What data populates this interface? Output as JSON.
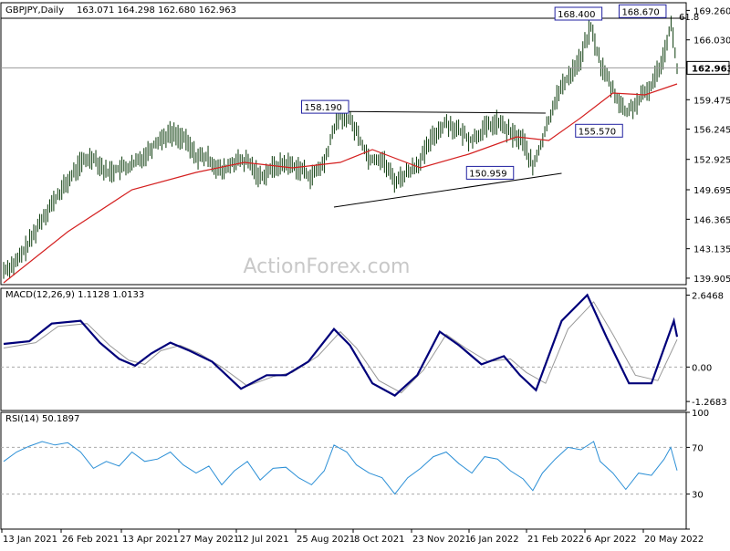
{
  "chart_data": [
    {
      "type": "candlestick-ohlc",
      "title": "GBPJPY,Daily",
      "ohlc_readout": [
        "163.071",
        "164.298",
        "162.680",
        "162.963"
      ],
      "watermark": "ActionForex.com",
      "ylim": [
        139.2,
        170.1
      ],
      "y_ticks": [
        169.26,
        166.03,
        162.8,
        159.47,
        156.25,
        152.93,
        149.6,
        146.365,
        143.135,
        139.905
      ],
      "y_tick_labels": [
        "169.260",
        "166.030",
        "",
        "159.475",
        "156.245",
        "152.925",
        "149.695",
        "146.365",
        "143.135",
        "139.905"
      ],
      "current_price": 162.963,
      "current_price_label": "162.963",
      "x_dates": [
        "13 Jan 2021",
        "26 Feb 2021",
        "13 Apr 2021",
        "27 May 2021",
        "12 Jul 2021",
        "25 Aug 2021",
        "8 Oct 2021",
        "23 Nov 2021",
        "6 Jan 2022",
        "21 Feb 2022",
        "6 Apr 2022",
        "20 May 2022"
      ],
      "close_trend": [
        [
          0,
          140.8
        ],
        [
          8,
          141.6
        ],
        [
          16,
          143.8
        ],
        [
          24,
          146.5
        ],
        [
          32,
          148.5
        ],
        [
          40,
          150.5
        ],
        [
          48,
          152.5
        ],
        [
          56,
          153.3
        ],
        [
          64,
          151.5
        ],
        [
          72,
          151.9
        ],
        [
          80,
          152.2
        ],
        [
          88,
          153.4
        ],
        [
          96,
          155.0
        ],
        [
          104,
          155.8
        ],
        [
          112,
          155.3
        ],
        [
          120,
          153.3
        ],
        [
          128,
          153.0
        ],
        [
          136,
          151.5
        ],
        [
          144,
          152.7
        ],
        [
          152,
          152.7
        ],
        [
          160,
          151.0
        ],
        [
          168,
          152.0
        ],
        [
          176,
          152.5
        ],
        [
          184,
          152.0
        ],
        [
          192,
          151.0
        ],
        [
          200,
          152.5
        ],
        [
          208,
          157.5
        ],
        [
          214,
          157.8
        ],
        [
          220,
          156.0
        ],
        [
          228,
          153.0
        ],
        [
          236,
          153.0
        ],
        [
          244,
          150.5
        ],
        [
          252,
          151.5
        ],
        [
          260,
          152.8
        ],
        [
          268,
          155.5
        ],
        [
          276,
          157.0
        ],
        [
          284,
          156.0
        ],
        [
          292,
          155.0
        ],
        [
          300,
          156.3
        ],
        [
          308,
          157.0
        ],
        [
          316,
          155.8
        ],
        [
          324,
          155.0
        ],
        [
          330,
          152.0
        ],
        [
          336,
          155.0
        ],
        [
          344,
          159.5
        ],
        [
          352,
          162.0
        ],
        [
          360,
          164.0
        ],
        [
          366,
          167.5
        ],
        [
          372,
          163.5
        ],
        [
          380,
          160.5
        ],
        [
          388,
          158.0
        ],
        [
          396,
          159.3
        ],
        [
          404,
          161.0
        ],
        [
          412,
          164.5
        ],
        [
          416,
          168.0
        ],
        [
          420,
          162.963
        ]
      ],
      "moving_average": [
        [
          0,
          139.4
        ],
        [
          40,
          145.0
        ],
        [
          80,
          149.6
        ],
        [
          120,
          151.5
        ],
        [
          150,
          152.6
        ],
        [
          180,
          152.0
        ],
        [
          210,
          152.6
        ],
        [
          230,
          154.0
        ],
        [
          260,
          152.0
        ],
        [
          290,
          153.5
        ],
        [
          320,
          155.4
        ],
        [
          340,
          155.0
        ],
        [
          360,
          157.5
        ],
        [
          380,
          160.2
        ],
        [
          400,
          160.0
        ],
        [
          420,
          161.2
        ]
      ],
      "labels": [
        {
          "text": "168.400",
          "bar": 372,
          "price": 168.4
        },
        {
          "text": "168.670",
          "bar": 412,
          "price": 168.67
        },
        {
          "text": "61.8",
          "bar": 420,
          "price": 168.1
        },
        {
          "text": "158.190",
          "bar": 214,
          "price": 158.19
        },
        {
          "text": "155.570",
          "bar": 386,
          "price": 155.57
        },
        {
          "text": "150.959",
          "bar": 318,
          "price": 150.959
        }
      ],
      "horizontal_lines": [
        168.4,
        162.963
      ],
      "trendlines": [
        {
          "from": [
            208,
            158.19
          ],
          "to": [
            338,
            158.0
          ]
        },
        {
          "from": [
            206,
            147.7
          ],
          "to": [
            348,
            151.4
          ]
        }
      ]
    },
    {
      "type": "line",
      "indicator": "MACD",
      "label": "MACD(12,26,9) 1.1128 1.0133",
      "ylim": [
        -1.6,
        2.9
      ],
      "y_ticks": [
        2.6468,
        0.0,
        -1.2683
      ],
      "y_tick_labels": [
        "2.6468",
        "0.00",
        "-1.2683"
      ],
      "macd": [
        [
          0,
          0.85
        ],
        [
          16,
          0.95
        ],
        [
          30,
          1.6
        ],
        [
          48,
          1.7
        ],
        [
          60,
          0.9
        ],
        [
          72,
          0.3
        ],
        [
          82,
          0.05
        ],
        [
          92,
          0.5
        ],
        [
          104,
          0.9
        ],
        [
          116,
          0.6
        ],
        [
          130,
          0.2
        ],
        [
          148,
          -0.8
        ],
        [
          164,
          -0.3
        ],
        [
          176,
          -0.3
        ],
        [
          190,
          0.2
        ],
        [
          206,
          1.4
        ],
        [
          216,
          0.8
        ],
        [
          230,
          -0.6
        ],
        [
          244,
          -1.05
        ],
        [
          258,
          -0.3
        ],
        [
          272,
          1.3
        ],
        [
          284,
          0.8
        ],
        [
          298,
          0.1
        ],
        [
          312,
          0.4
        ],
        [
          322,
          -0.3
        ],
        [
          332,
          -0.85
        ],
        [
          348,
          1.7
        ],
        [
          364,
          2.65
        ],
        [
          376,
          1.1
        ],
        [
          390,
          -0.6
        ],
        [
          404,
          -0.6
        ],
        [
          418,
          1.7
        ],
        [
          420,
          1.1128
        ]
      ],
      "signal": [
        [
          0,
          0.7
        ],
        [
          20,
          0.9
        ],
        [
          34,
          1.5
        ],
        [
          52,
          1.6
        ],
        [
          66,
          0.8
        ],
        [
          78,
          0.25
        ],
        [
          88,
          0.1
        ],
        [
          98,
          0.6
        ],
        [
          110,
          0.8
        ],
        [
          122,
          0.5
        ],
        [
          136,
          0.0
        ],
        [
          152,
          -0.7
        ],
        [
          168,
          -0.35
        ],
        [
          180,
          -0.2
        ],
        [
          196,
          0.4
        ],
        [
          210,
          1.3
        ],
        [
          220,
          0.7
        ],
        [
          234,
          -0.5
        ],
        [
          248,
          -0.95
        ],
        [
          262,
          -0.1
        ],
        [
          276,
          1.2
        ],
        [
          288,
          0.7
        ],
        [
          302,
          0.2
        ],
        [
          316,
          0.3
        ],
        [
          326,
          -0.2
        ],
        [
          338,
          -0.6
        ],
        [
          352,
          1.4
        ],
        [
          368,
          2.4
        ],
        [
          380,
          1.2
        ],
        [
          394,
          -0.3
        ],
        [
          408,
          -0.5
        ],
        [
          420,
          1.0133
        ]
      ]
    },
    {
      "type": "line",
      "indicator": "RSI",
      "label": "RSI(14) 50.1897",
      "ylim": [
        0,
        100
      ],
      "y_ticks": [
        100,
        70,
        30,
        0
      ],
      "y_tick_labels": [
        "100",
        "70",
        "30",
        "0"
      ],
      "rsi": [
        [
          0,
          58
        ],
        [
          8,
          66
        ],
        [
          16,
          71
        ],
        [
          24,
          75
        ],
        [
          32,
          72
        ],
        [
          40,
          74
        ],
        [
          48,
          66
        ],
        [
          56,
          52
        ],
        [
          64,
          58
        ],
        [
          72,
          54
        ],
        [
          80,
          66
        ],
        [
          88,
          58
        ],
        [
          96,
          60
        ],
        [
          104,
          66
        ],
        [
          112,
          55
        ],
        [
          120,
          48
        ],
        [
          128,
          54
        ],
        [
          136,
          38
        ],
        [
          144,
          50
        ],
        [
          152,
          58
        ],
        [
          160,
          42
        ],
        [
          168,
          52
        ],
        [
          176,
          53
        ],
        [
          184,
          44
        ],
        [
          192,
          38
        ],
        [
          200,
          50
        ],
        [
          206,
          72
        ],
        [
          214,
          66
        ],
        [
          220,
          55
        ],
        [
          228,
          48
        ],
        [
          236,
          44
        ],
        [
          244,
          30
        ],
        [
          252,
          44
        ],
        [
          260,
          52
        ],
        [
          268,
          62
        ],
        [
          276,
          66
        ],
        [
          284,
          56
        ],
        [
          292,
          48
        ],
        [
          300,
          62
        ],
        [
          308,
          60
        ],
        [
          316,
          50
        ],
        [
          324,
          43
        ],
        [
          330,
          33
        ],
        [
          336,
          48
        ],
        [
          344,
          60
        ],
        [
          352,
          70
        ],
        [
          360,
          68
        ],
        [
          368,
          75
        ],
        [
          372,
          58
        ],
        [
          380,
          48
        ],
        [
          388,
          34
        ],
        [
          396,
          48
        ],
        [
          404,
          46
        ],
        [
          412,
          60
        ],
        [
          416,
          70
        ],
        [
          420,
          50.19
        ]
      ]
    }
  ]
}
